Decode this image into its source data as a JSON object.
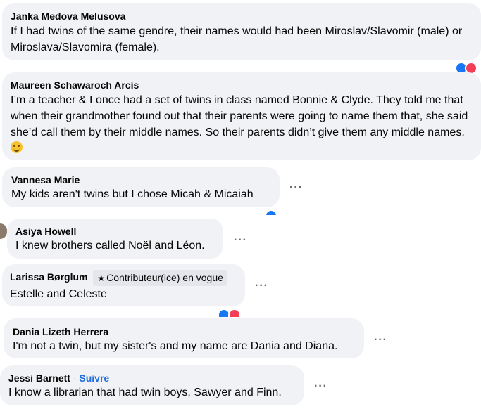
{
  "comments": [
    {
      "author": "Janka Medova Melusova",
      "text": "If I had twins of the same gendre, their names would had been Miroslav/Slavomir (male) or Miroslava/Slavomira (female)."
    },
    {
      "author": "Maureen Schawaroch Arcís",
      "text": "I’m a teacher & I once had a set of twins in class named Bonnie & Clyde. They told me that when their grandmother found out that their parents were going to name them that, she said she’d call them by their middle names. So their parents didn’t give them any middle names.",
      "emoji": "smiling-face-emoji"
    },
    {
      "author": "Vannesa Marie",
      "text": "My kids aren't twins but I chose Micah & Micaiah"
    },
    {
      "author": "Asiya Howell",
      "text": "I knew brothers called Noël and Léon."
    },
    {
      "author": "Larissa Børglum",
      "badge": "Contributeur(ice) en vogue",
      "badge_icon": "star-icon",
      "text": "Estelle and Celeste"
    },
    {
      "author": "Dania Lizeth Herrera",
      "text": "I'm not a twin, but my sister's and my name are Dania and Diana."
    },
    {
      "author": "Jessi Barnett",
      "separator": "·",
      "follow_label": "Suivre",
      "text": "I know a librarian that had twin boys, Sawyer and Finn."
    }
  ],
  "more_label": "···",
  "colors": {
    "bubble": "#f0f2f5",
    "follow": "#216fdb",
    "like": "#1877f2",
    "love": "#f33e58",
    "haha": "#f7b125"
  }
}
